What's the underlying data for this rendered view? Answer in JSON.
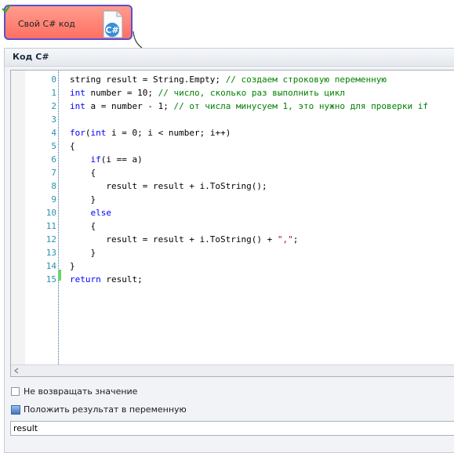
{
  "node": {
    "title": "Свой C# код",
    "icon": "csharp-file-icon",
    "check_icon": "green-check-icon",
    "fill_color": "#ff7b6e",
    "border_color": "#5b4fd0"
  },
  "panel": {
    "title": "Код C#"
  },
  "editor": {
    "lines": [
      {
        "n": "0",
        "segments": [
          {
            "t": "string result = String.Empty; ",
            "c": "nm"
          },
          {
            "t": "// создаем строковую переменную",
            "c": "cm"
          }
        ]
      },
      {
        "n": "1",
        "segments": [
          {
            "t": "int",
            "c": "kw"
          },
          {
            "t": " number = ",
            "c": "nm"
          },
          {
            "t": "10",
            "c": "nm"
          },
          {
            "t": "; ",
            "c": "nm"
          },
          {
            "t": "// число, сколько раз выполнить цикл",
            "c": "cm"
          }
        ]
      },
      {
        "n": "2",
        "segments": [
          {
            "t": "int",
            "c": "kw"
          },
          {
            "t": " a = number - ",
            "c": "nm"
          },
          {
            "t": "1",
            "c": "nm"
          },
          {
            "t": "; ",
            "c": "nm"
          },
          {
            "t": "// от числа минусуем 1, это нужно для проверки if",
            "c": "cm"
          }
        ]
      },
      {
        "n": "3",
        "segments": []
      },
      {
        "n": "4",
        "segments": [
          {
            "t": "for",
            "c": "kw"
          },
          {
            "t": "(",
            "c": "nm"
          },
          {
            "t": "int",
            "c": "kw"
          },
          {
            "t": " i = 0; i < number; i++)",
            "c": "nm"
          }
        ]
      },
      {
        "n": "5",
        "segments": [
          {
            "t": "{",
            "c": "nm"
          }
        ]
      },
      {
        "n": "6",
        "segments": [
          {
            "t": "    ",
            "c": "nm"
          },
          {
            "t": "if",
            "c": "kw"
          },
          {
            "t": "(i == a)",
            "c": "nm"
          }
        ]
      },
      {
        "n": "7",
        "segments": [
          {
            "t": "    {",
            "c": "nm"
          }
        ]
      },
      {
        "n": "8",
        "segments": [
          {
            "t": "       result = result + i.ToString();",
            "c": "nm"
          }
        ]
      },
      {
        "n": "9",
        "segments": [
          {
            "t": "    }",
            "c": "nm"
          }
        ]
      },
      {
        "n": "10",
        "segments": [
          {
            "t": "    ",
            "c": "nm"
          },
          {
            "t": "else",
            "c": "kw"
          }
        ]
      },
      {
        "n": "11",
        "segments": [
          {
            "t": "    {",
            "c": "nm"
          }
        ]
      },
      {
        "n": "12",
        "segments": [
          {
            "t": "       result = result + i.ToString() + ",
            "c": "nm"
          },
          {
            "t": "\",\"",
            "c": "st"
          },
          {
            "t": ";",
            "c": "nm"
          }
        ]
      },
      {
        "n": "13",
        "segments": [
          {
            "t": "    }",
            "c": "nm"
          }
        ]
      },
      {
        "n": "14",
        "segments": [
          {
            "t": "}",
            "c": "nm"
          }
        ]
      },
      {
        "n": "15",
        "segments": [
          {
            "t": "return",
            "c": "kw"
          },
          {
            "t": " result;",
            "c": "nm"
          }
        ]
      }
    ],
    "colors": {
      "keyword": "#0000ff",
      "comment": "#008000",
      "string": "#a31515",
      "line_number": "#2b91af",
      "change_marker": "#6fd16f"
    }
  },
  "options": {
    "no_return_label": "Не возвращать значение",
    "no_return_checked": false,
    "put_result_label": "Положить результат в переменную",
    "put_result_checked": true,
    "variable_value": "result",
    "variable_placeholder": ""
  }
}
